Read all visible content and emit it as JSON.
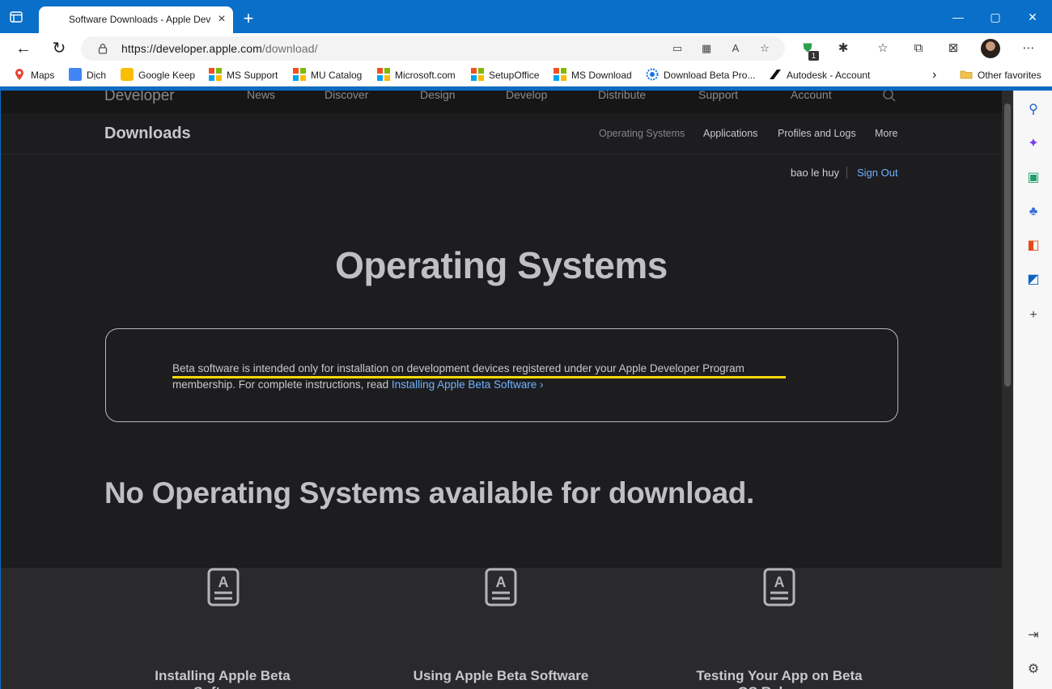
{
  "browser": {
    "tab_title": "Software Downloads - Apple Dev",
    "tab_close": "×",
    "new_tab": "+",
    "window_controls": [
      "—",
      "▢",
      "✕"
    ],
    "url_host": "https://developer.apple.com",
    "url_path": "/download/",
    "favorites": [
      {
        "label": "Maps",
        "icon": "maps-pin-icon"
      },
      {
        "label": "Dịch",
        "icon": "google-translate-icon"
      },
      {
        "label": "Google Keep",
        "icon": "google-keep-icon"
      },
      {
        "label": "MS Support",
        "icon": "microsoft-logo-icon"
      },
      {
        "label": "MU Catalog",
        "icon": "microsoft-logo-icon"
      },
      {
        "label": "Microsoft.com",
        "icon": "microsoft-logo-icon"
      },
      {
        "label": "SetupOffice",
        "icon": "microsoft-logo-icon"
      },
      {
        "label": "MS Download",
        "icon": "microsoft-logo-icon"
      },
      {
        "label": "Download Beta Pro...",
        "icon": "gear-badge-icon"
      },
      {
        "label": "Autodesk - Account",
        "icon": "autodesk-logo-icon"
      }
    ],
    "other_favorites": "Other favorites",
    "extension_badge": "1",
    "colors": {
      "titlebar": "#0a6fc8",
      "accent": "#0067c0"
    }
  },
  "site": {
    "logo": "Developer",
    "global_nav": [
      "News",
      "Discover",
      "Design",
      "Develop",
      "Distribute",
      "Support",
      "Account"
    ],
    "local_title": "Downloads",
    "local_nav": [
      "Operating Systems",
      "Applications",
      "Profiles and Logs",
      "More"
    ],
    "user_name": "bao le huy",
    "sign_out": "Sign Out",
    "heading": "Operating Systems",
    "notice_text": "Beta software is intended only for installation on development devices registered under your Apple Developer Program membership. For complete instructions, read ",
    "notice_link": "Installing Apple Beta Software ›",
    "empty_heading": "No Operating Systems available for download.",
    "resources": [
      {
        "title": "Installing Apple Beta Software"
      },
      {
        "title": "Using Apple Beta Software"
      },
      {
        "title": "Testing Your App on Beta OS Releases"
      }
    ],
    "colors": {
      "background": "#1d1d1f",
      "link": "#6fb1ff",
      "highlight": "#f5d90a"
    }
  }
}
